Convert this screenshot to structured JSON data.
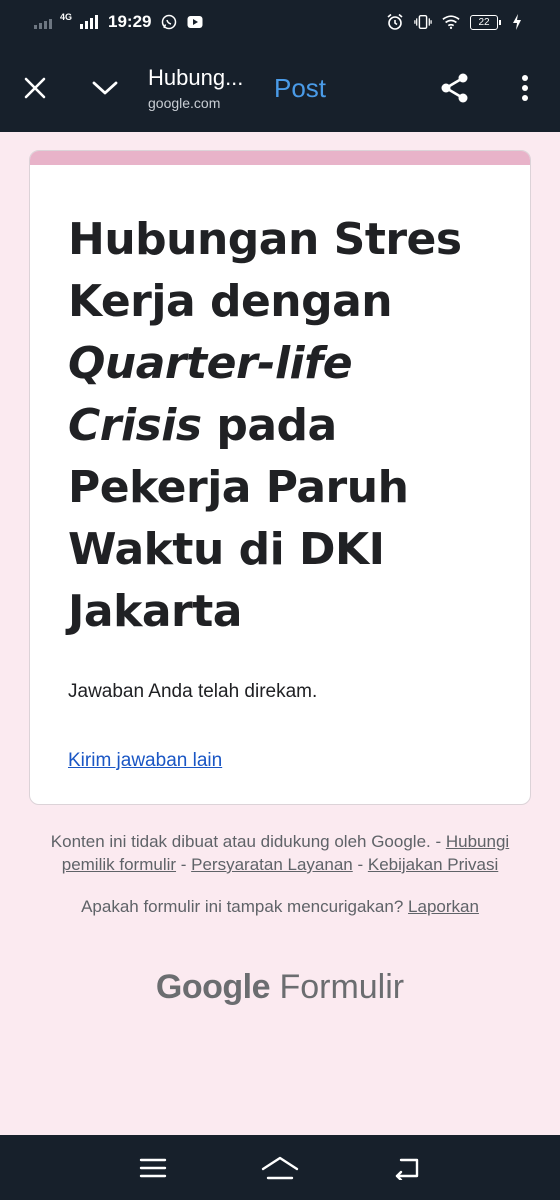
{
  "status_bar": {
    "network": "4G",
    "time": "19:29",
    "battery": "22"
  },
  "toolbar": {
    "title": "Hubung...",
    "url": "google.com",
    "post_label": "Post",
    "icons": [
      "close-icon",
      "chevron-down-icon",
      "share-icon",
      "more-vert-icon"
    ]
  },
  "form": {
    "title_part1": "Hubungan Stres Kerja dengan ",
    "title_italic1": "Quarter-life",
    "title_italic2": "Crisis",
    "title_part2": " pada Pekerja Paruh Waktu di DKI Jakarta",
    "confirmation": "Jawaban Anda telah direkam.",
    "another_response": "Kirim jawaban lain",
    "accent_color": "#e8b3c9"
  },
  "footer": {
    "disclaimer": "Konten ini tidak dibuat atau didukung oleh Google.",
    "sep": " - ",
    "contact_owner": "Hubungi pemilik formulir",
    "terms": "Persyaratan Layanan",
    "privacy": "Kebijakan Privasi",
    "suspicious": "Apakah formulir ini tampak mencurigakan?",
    "report": "Laporkan",
    "logo_google": "Google",
    "logo_forms": "Formulir"
  },
  "nav_bar": {
    "icons": [
      "menu-icon",
      "home-icon",
      "back-icon"
    ]
  }
}
